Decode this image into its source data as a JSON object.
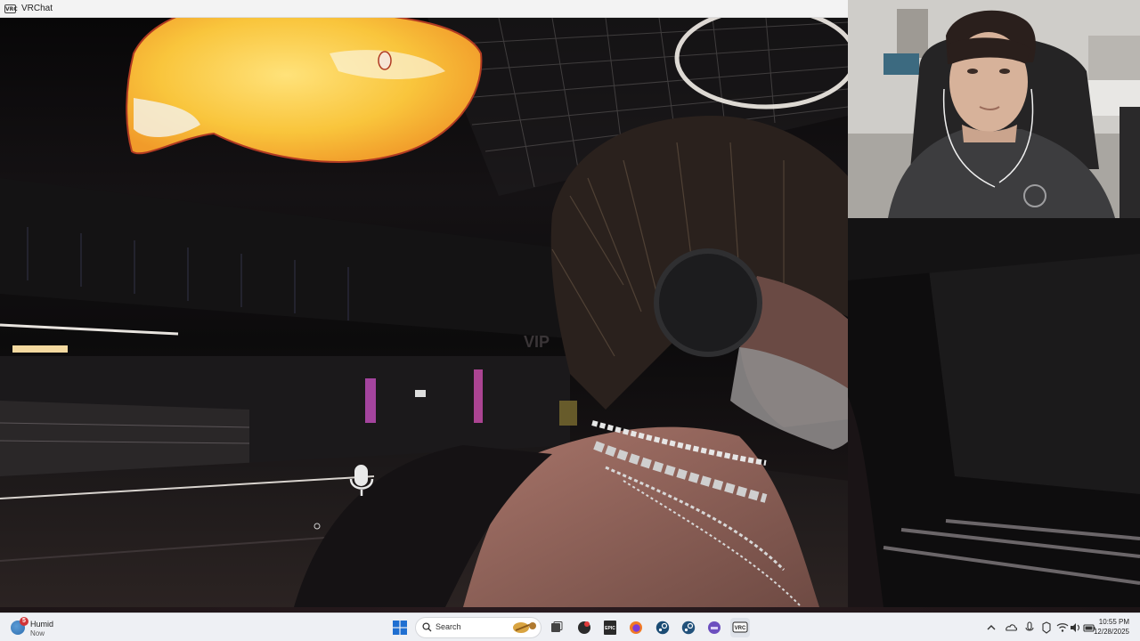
{
  "window": {
    "icon_text": "VRC",
    "title": "VRChat"
  },
  "scene": {
    "vip_sign": "VIP"
  },
  "taskbar": {
    "weather": {
      "badge": "5",
      "title": "Humid",
      "subtitle": "Now"
    },
    "search": {
      "placeholder": "Search"
    },
    "pinned": [
      {
        "name": "start-button"
      },
      {
        "name": "task-view-icon"
      },
      {
        "name": "vr-app-icon"
      },
      {
        "name": "epic-games-icon"
      },
      {
        "name": "firefox-icon"
      },
      {
        "name": "steam-icon"
      },
      {
        "name": "steam-vr-icon"
      },
      {
        "name": "app-icon"
      },
      {
        "name": "vrchat-icon"
      }
    ],
    "epic_label": "EPIC",
    "vrc_label": "VRC",
    "clock": {
      "time": "10:55 PM",
      "date": "12/28/2025"
    }
  }
}
